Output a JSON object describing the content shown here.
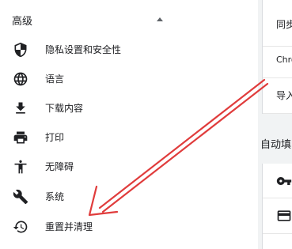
{
  "sidebar": {
    "section_title": "高级",
    "items": [
      {
        "label": "隐私设置和安全性",
        "icon": "shield-icon"
      },
      {
        "label": "语言",
        "icon": "globe-icon"
      },
      {
        "label": "下载内容",
        "icon": "download-icon"
      },
      {
        "label": "打印",
        "icon": "printer-icon"
      },
      {
        "label": "无障碍",
        "icon": "accessibility-icon"
      },
      {
        "label": "系统",
        "icon": "wrench-icon"
      },
      {
        "label": "重置并清理",
        "icon": "reset-history-icon"
      }
    ]
  },
  "main": {
    "sync_card": [
      {
        "text": "同步"
      },
      {
        "text": "Chro"
      },
      {
        "text": "导入"
      }
    ],
    "autofill_title": "自动填",
    "autofill_rows": [
      {
        "icon": "key-icon"
      },
      {
        "icon": "credit-card-icon"
      }
    ]
  },
  "annotation": {
    "type": "arrow",
    "color": "#e03c3c",
    "points_to": "重置并清理"
  },
  "colors": {
    "icon": "#202124",
    "text": "#202124",
    "page_background": "#f1f3f4"
  }
}
